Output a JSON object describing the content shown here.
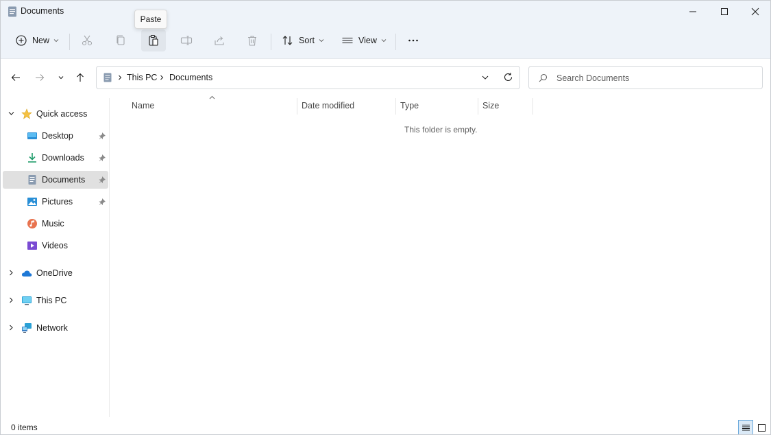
{
  "window": {
    "title": "Documents"
  },
  "tooltip": {
    "text": "Paste"
  },
  "toolbar": {
    "new_label": "New",
    "sort_label": "Sort",
    "view_label": "View"
  },
  "address": {
    "crumbs": [
      "This PC",
      "Documents"
    ]
  },
  "search": {
    "placeholder": "Search Documents",
    "value": ""
  },
  "sidebar": {
    "quick_access": "Quick access",
    "items": [
      {
        "label": "Desktop",
        "pinned": true
      },
      {
        "label": "Downloads",
        "pinned": true
      },
      {
        "label": "Documents",
        "pinned": true,
        "selected": true
      },
      {
        "label": "Pictures",
        "pinned": true
      },
      {
        "label": "Music",
        "pinned": false
      },
      {
        "label": "Videos",
        "pinned": false
      }
    ],
    "onedrive": "OneDrive",
    "this_pc": "This PC",
    "network": "Network"
  },
  "columns": [
    "Name",
    "Date modified",
    "Type",
    "Size"
  ],
  "content": {
    "empty_message": "This folder is empty."
  },
  "status": {
    "count": "0 items"
  },
  "colors": {
    "chrome_bg": "#eef3f9",
    "accent": "#0067c0",
    "selected_item": "#e0e0e0"
  }
}
